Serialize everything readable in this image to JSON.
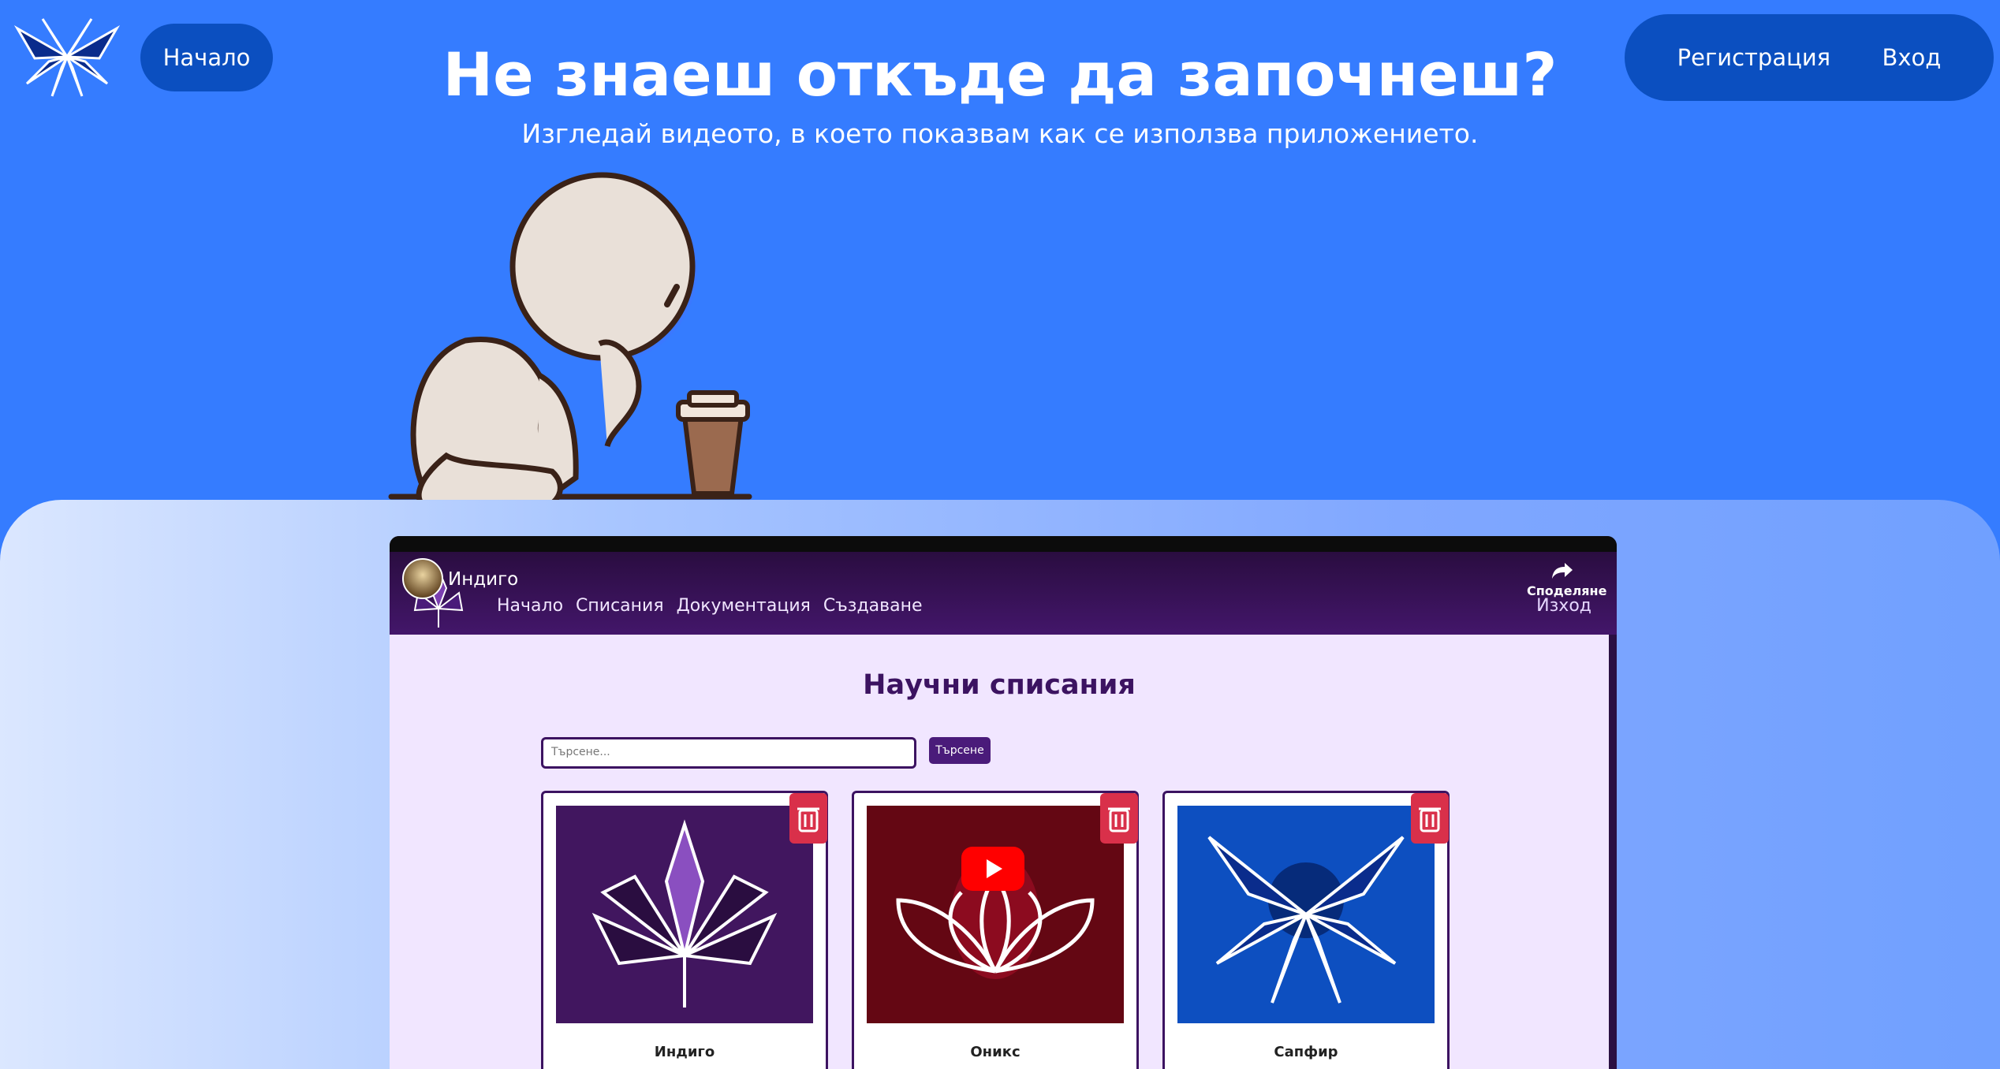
{
  "header": {
    "home_label": "Начало",
    "register_label": "Регистрация",
    "login_label": "Вход"
  },
  "hero": {
    "title": "Не знаеш откъде да започнеш?",
    "subtitle": "Изгледай видеото, в което показвам как се използва приложението."
  },
  "video": {
    "channel_title": "Индиго",
    "share_label": "Споделяне",
    "nav_links": [
      "Начало",
      "Списания",
      "Документация",
      "Създаване"
    ],
    "exit_label": "Изход",
    "app": {
      "heading": "Научни списания",
      "search_placeholder": "Търсене...",
      "search_button": "Търсене",
      "cards": [
        {
          "name": "Индиго",
          "bg": "#41165f"
        },
        {
          "name": "Оникс",
          "bg": "#640713"
        },
        {
          "name": "Сапфир",
          "bg": "#0d4fc0"
        }
      ]
    }
  },
  "colors": {
    "page_bg": "#357cff",
    "pill_bg": "#0b4fc0",
    "app_purple": "#3c1361",
    "app_bg": "#f1e6ff",
    "delete_red": "#d9304a"
  }
}
